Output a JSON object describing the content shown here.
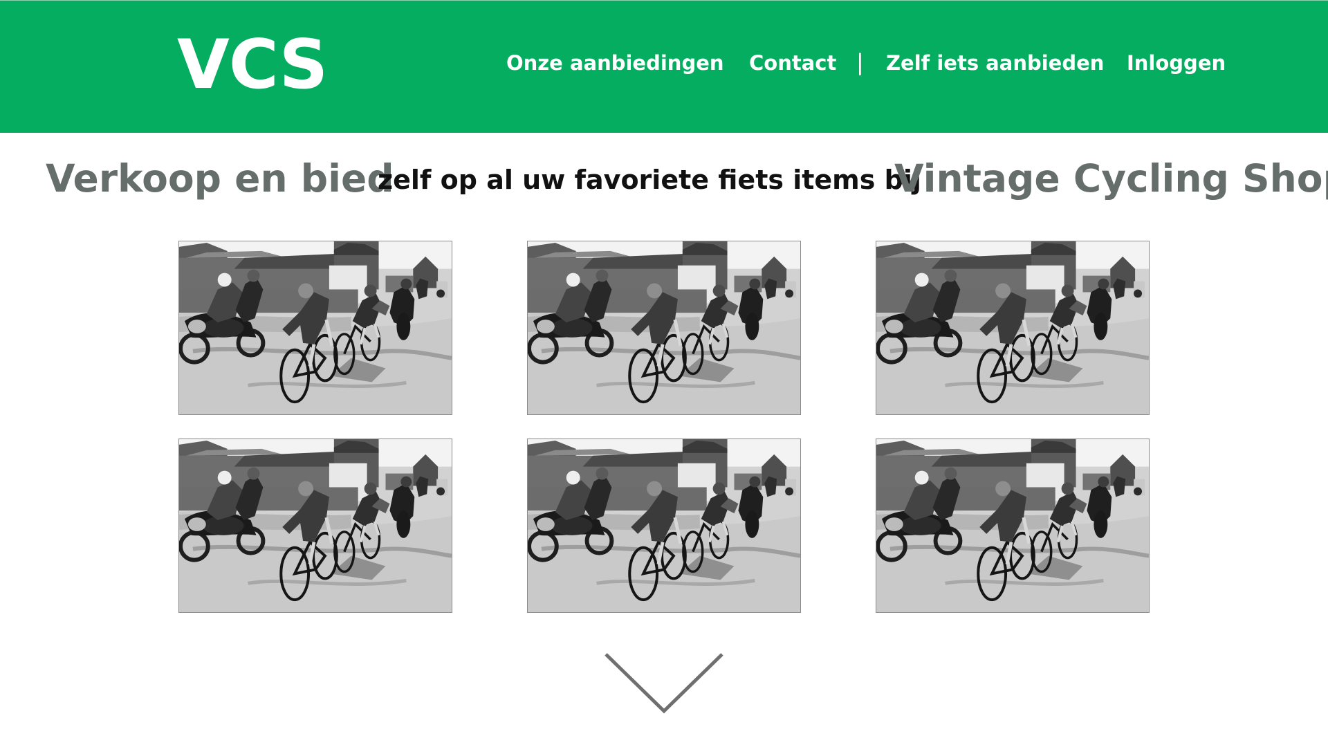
{
  "header": {
    "logo": "VCS",
    "nav": [
      {
        "label": "Onze aanbiedingen"
      },
      {
        "label": "Contact"
      },
      {
        "label": "Zelf iets aanbieden"
      },
      {
        "label": "Inloggen"
      }
    ],
    "separator": "|"
  },
  "tagline": {
    "left": "Verkoop en bied",
    "middle": "zelf op al uw favoriete fiets items bij",
    "right": "Vintage Cycling Shop"
  },
  "gallery": {
    "items": [
      {
        "image": "vintage-cycling-race-photo"
      },
      {
        "image": "vintage-cycling-race-photo"
      },
      {
        "image": "vintage-cycling-race-photo"
      },
      {
        "image": "vintage-cycling-race-photo"
      },
      {
        "image": "vintage-cycling-race-photo"
      },
      {
        "image": "vintage-cycling-race-photo"
      }
    ]
  },
  "icons": {
    "scroll_down": "chevron-down-icon"
  },
  "colors": {
    "header_background": "#04ad5f",
    "header_text": "#ffffff",
    "tagline_gray": "#666e6c",
    "tagline_dark": "#111111",
    "arrow": "#6f6f6f"
  }
}
